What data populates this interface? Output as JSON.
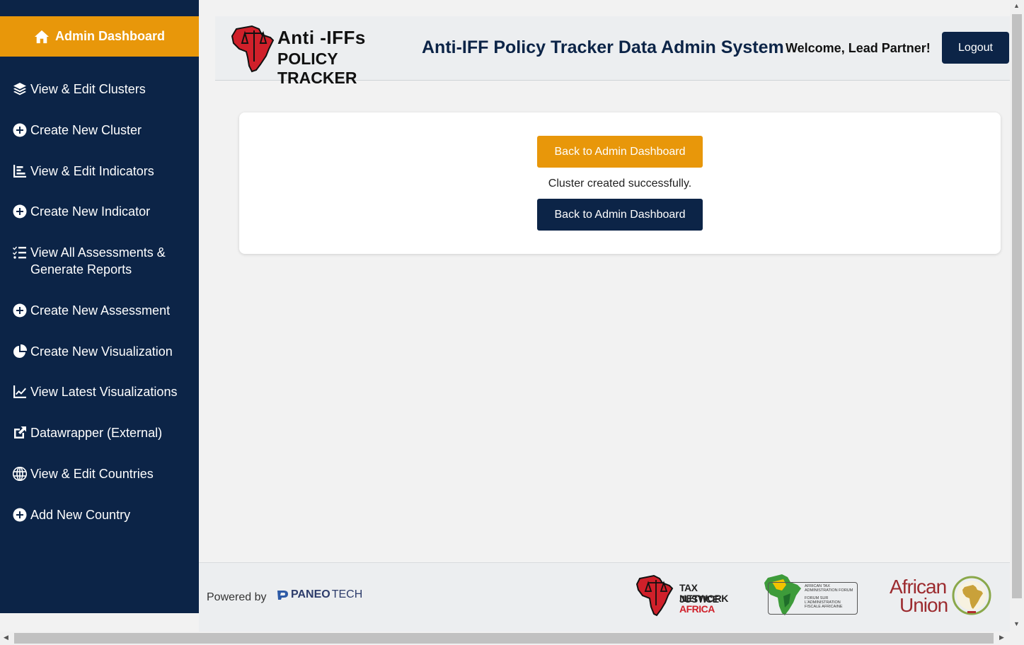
{
  "sidebar": {
    "header_label": "Admin Dashboard",
    "items": [
      {
        "label": "View & Edit Clusters",
        "icon": "layers-icon"
      },
      {
        "label": "Create New Cluster",
        "icon": "plus-circle-icon"
      },
      {
        "label": "View & Edit Indicators",
        "icon": "bar-chart-icon"
      },
      {
        "label": "Create New Indicator",
        "icon": "plus-circle-icon"
      },
      {
        "label": "View All Assessments & Generate Reports",
        "icon": "list-check-icon"
      },
      {
        "label": "Create New Assessment",
        "icon": "plus-circle-icon"
      },
      {
        "label": "Create New Visualization",
        "icon": "pie-chart-icon"
      },
      {
        "label": "View Latest Visualizations",
        "icon": "line-chart-icon"
      },
      {
        "label": "Datawrapper (External)",
        "icon": "external-link-icon"
      },
      {
        "label": "View & Edit Countries",
        "icon": "globe-icon"
      },
      {
        "label": "Add New Country",
        "icon": "plus-circle-icon"
      }
    ]
  },
  "header": {
    "logo_line1": "Anti -IFFs",
    "logo_line2": "POLICY TRACKER",
    "title": "Anti-IFF Policy Tracker Data Admin System",
    "welcome": "Welcome, Lead Partner!",
    "logout_label": "Logout"
  },
  "main": {
    "back_button_top": "Back to Admin Dashboard",
    "message": "Cluster created successfully.",
    "back_button_bottom": "Back to Admin Dashboard"
  },
  "footer": {
    "powered_by": "Powered by",
    "paneo_left": "PANEO",
    "paneo_right": "TECH",
    "tjna_line1": "TAX JUSTICE",
    "tjna_line2": "NETWORK",
    "tjna_line3": "AFRICA",
    "ataf_line1": "AFRICAN TAX",
    "ataf_line2": "ADMINISTRATION FORUM",
    "ataf_line3": "FORUM SUR",
    "ataf_line4": "L'ADMINISTRATION",
    "ataf_line5": "FISCALE AFRICAINE",
    "au_line1": "African",
    "au_line2": "Union"
  },
  "colors": {
    "navy": "#0c2447",
    "orange": "#e8970a",
    "africa_red": "#d0202a"
  }
}
